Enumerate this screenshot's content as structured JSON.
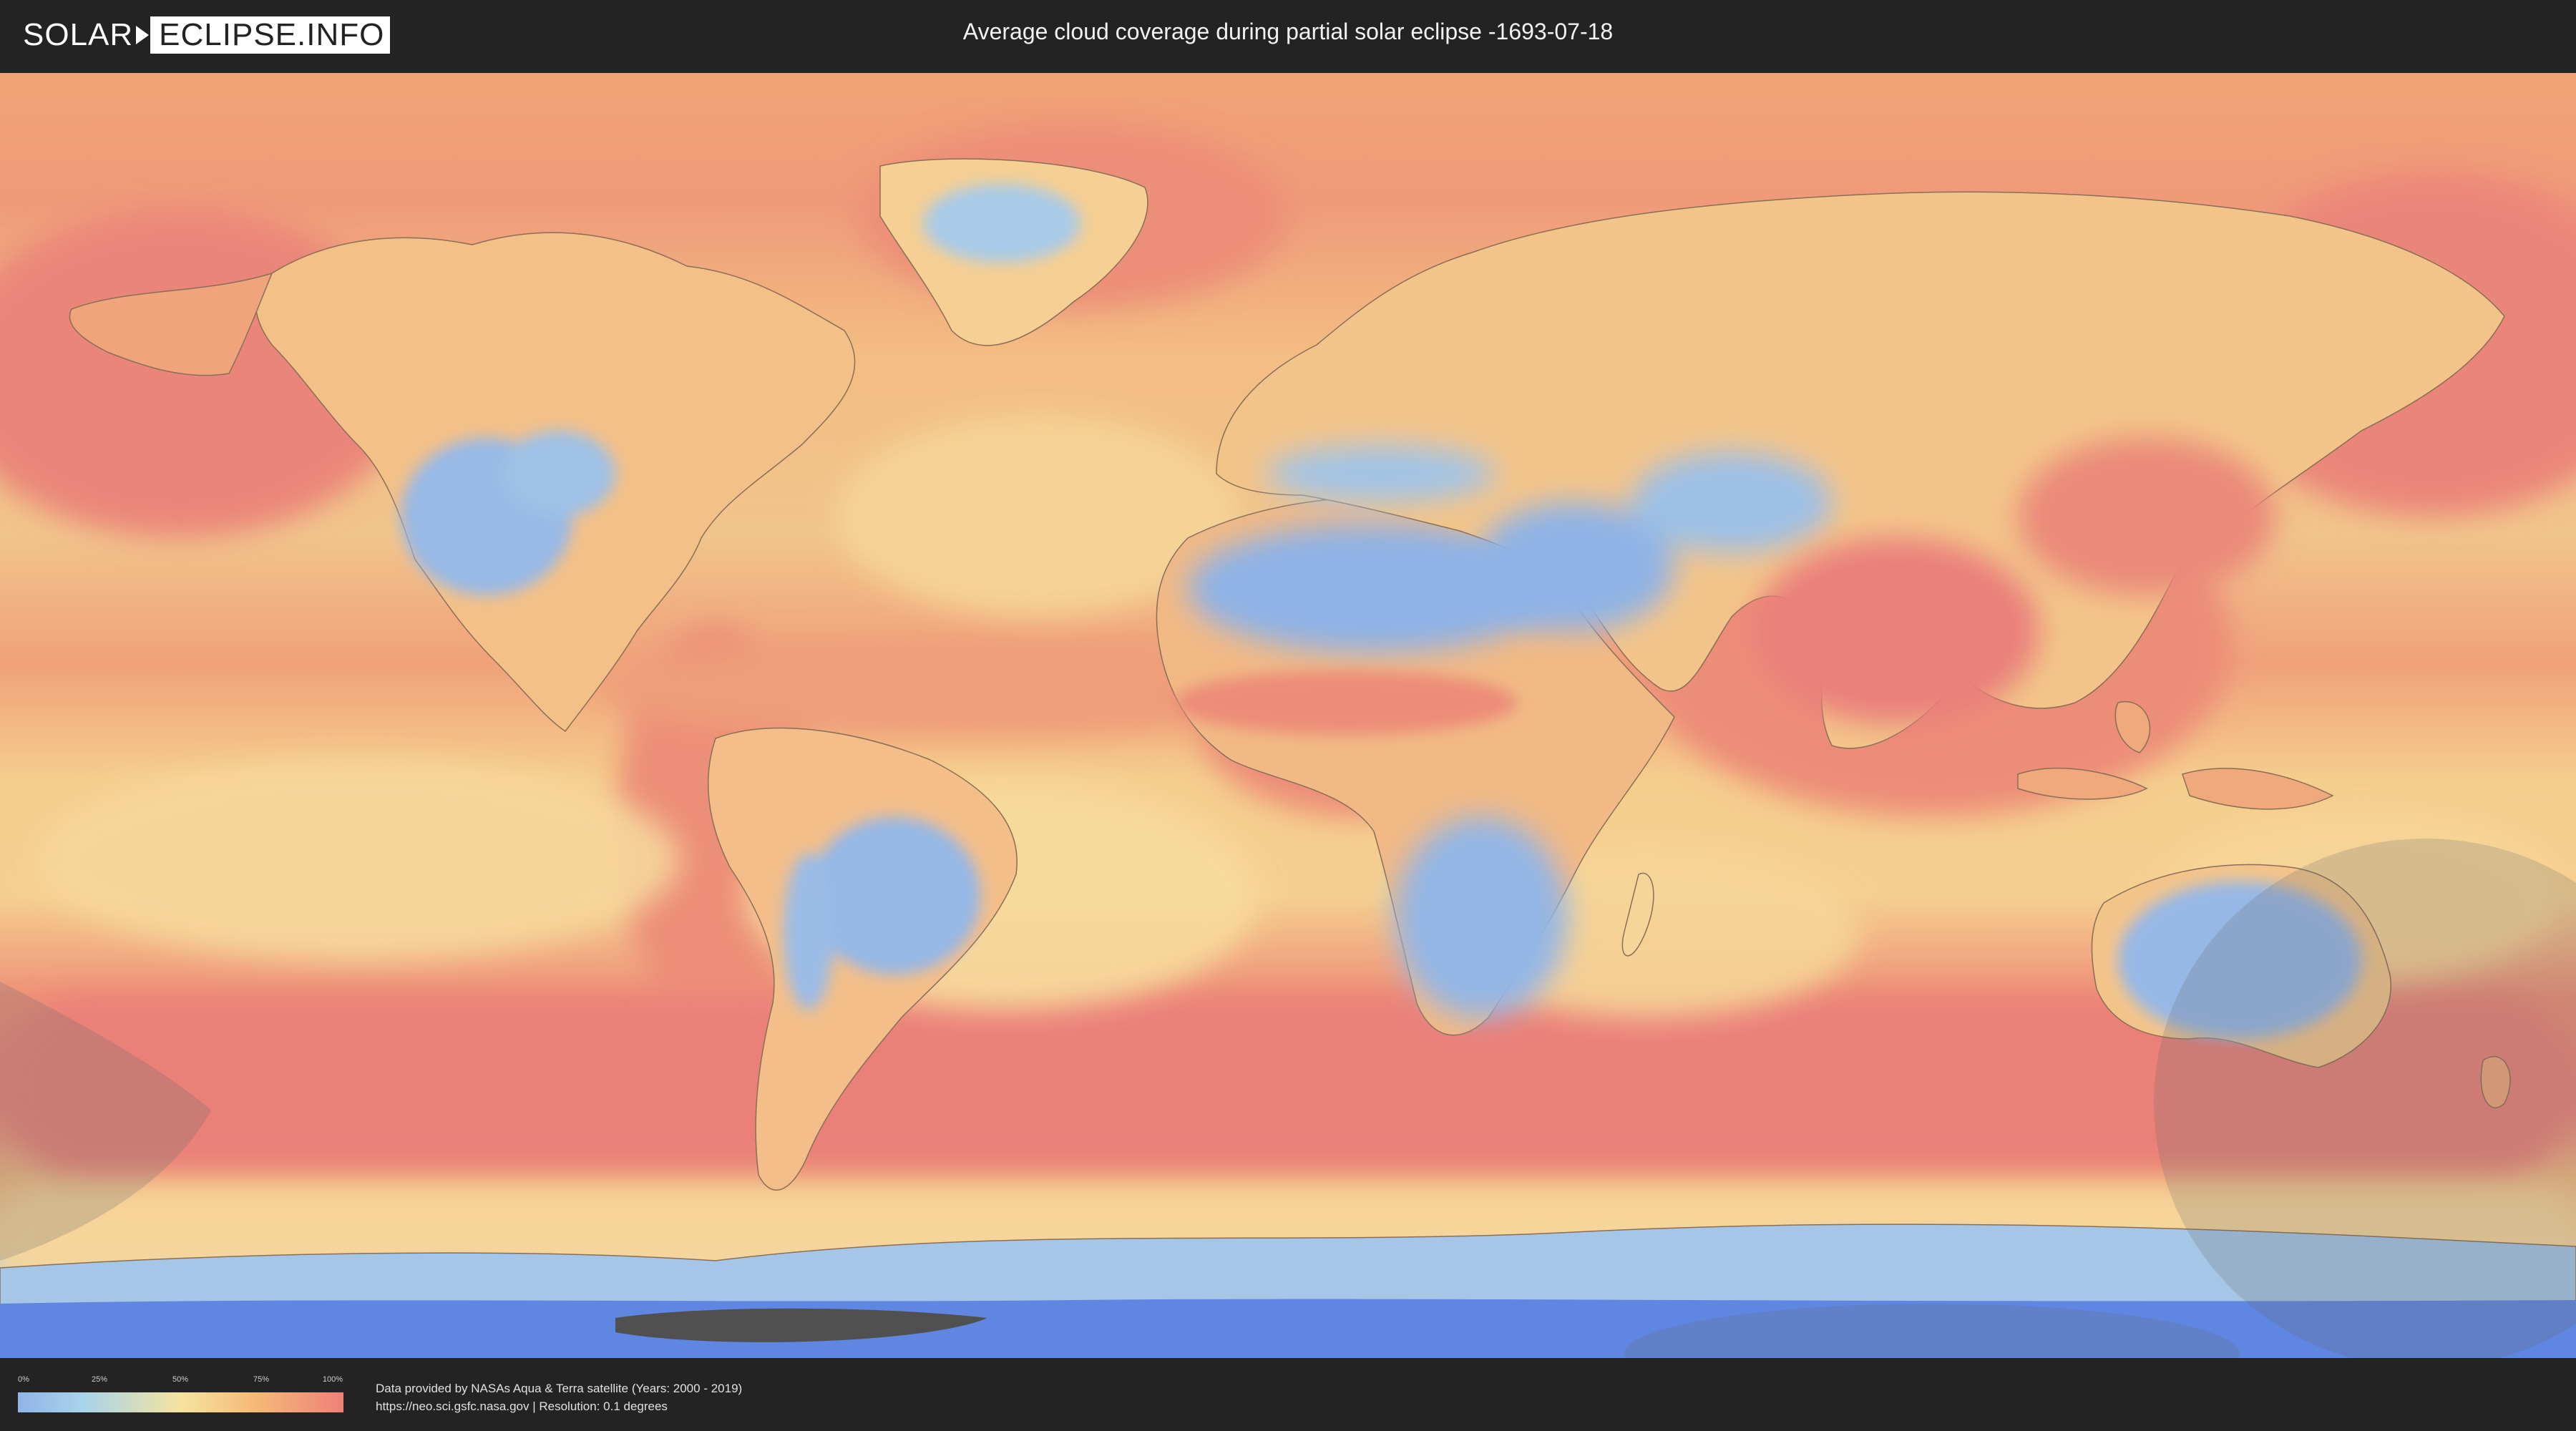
{
  "header": {
    "logo_left": "SOLAR",
    "logo_right": "ECLIPSE.INFO",
    "title": "Average cloud coverage during partial solar eclipse -1693-07-18"
  },
  "legend": {
    "ticks": [
      "0%",
      "25%",
      "50%",
      "75%",
      "100%"
    ],
    "colors": {
      "low": "#8fb4e8",
      "mid": "#f5e3a0",
      "high": "#ee8179"
    }
  },
  "footer": {
    "line1": "Data provided by NASAs Aqua & Terra satellite (Years: 2000 - 2019)",
    "line2": "https://neo.sci.gsfc.nasa.gov | Resolution: 0.1 degrees"
  },
  "map": {
    "projection": "equirectangular",
    "palette": {
      "ocean_cloudy": "#ea8a78",
      "ocean_mid": "#f0b079",
      "clear": "#93b6e6",
      "partly": "#f6dc9c",
      "antarctic_ice": "#5f86e0",
      "shadow": "#6b6b6b"
    }
  }
}
